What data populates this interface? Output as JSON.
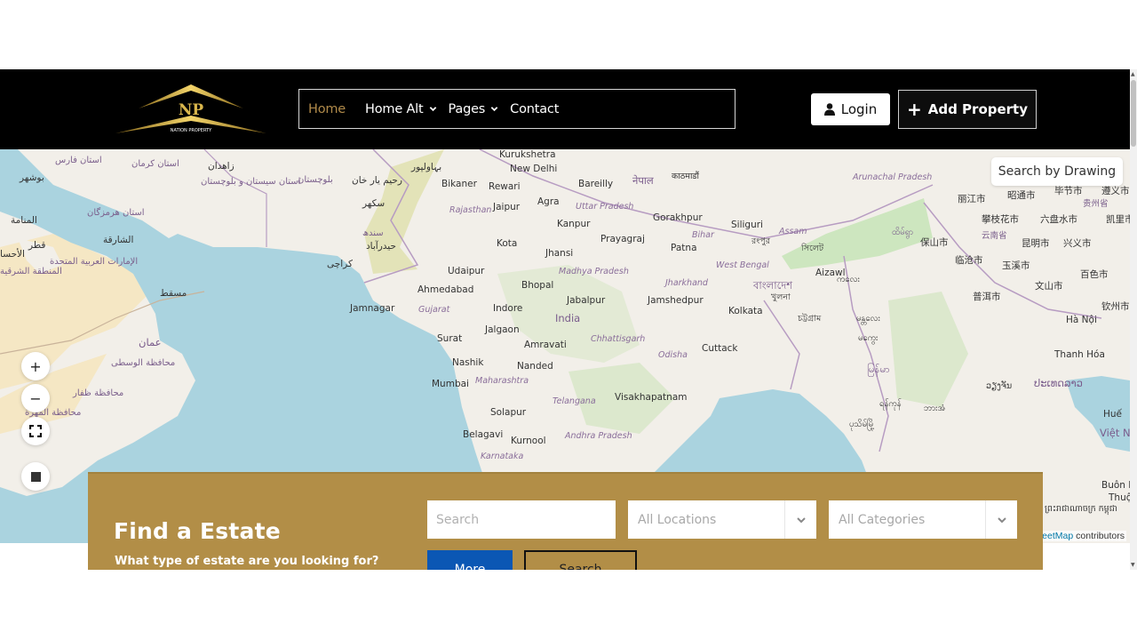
{
  "header": {
    "logo": {
      "initials": "NP",
      "brand": "NATION PROPERTY"
    },
    "nav": [
      {
        "label": "Home",
        "active": true,
        "has_dropdown": false
      },
      {
        "label": "Home Alt",
        "active": false,
        "has_dropdown": true
      },
      {
        "label": "Pages",
        "active": false,
        "has_dropdown": true
      },
      {
        "label": "Contact",
        "active": false,
        "has_dropdown": false
      }
    ],
    "login_label": "Login",
    "add_property_label": "Add Property",
    "icons": {
      "login": "user-icon",
      "add": "plus-icon"
    }
  },
  "map": {
    "search_by_drawing_label": "Search by Drawing",
    "controls": [
      {
        "name": "zoom-in",
        "glyph": "+"
      },
      {
        "name": "zoom-out",
        "glyph": "−"
      },
      {
        "name": "fullscreen",
        "glyph": "fullscreen-icon"
      },
      {
        "name": "draw-stop",
        "glyph": "square-icon"
      }
    ],
    "attribution": {
      "link": "reetMap",
      "text": " contributors"
    },
    "labels": {
      "cities": [
        "Kurukshetra",
        "New Delhi",
        "Bikaner",
        "Rewari",
        "Bareilly",
        "Jaipur",
        "Agra",
        "Gorakhpur",
        "Siliguri",
        "Kanpur",
        "Prayagraj",
        "Kota",
        "Jhansi",
        "Patna",
        "Udaipur",
        "Ahmedabad",
        "Bhopal",
        "Kolkata",
        "Jabalpur",
        "Jamshedpur",
        "Aizawl",
        "Jamnagar",
        "Indore",
        "Jalgaon",
        "Surat",
        "Amravati",
        "Cuttack",
        "Nashik",
        "Nanded",
        "Mumbai",
        "Visakhapatnam",
        "Solapur",
        "Belagavi",
        "Kurnool",
        "Hà Nội",
        "Thanh Hóa",
        "Huế",
        "Buôn M",
        "Thuộ"
      ],
      "states": [
        "Rajasthan",
        "Uttar Pradesh",
        "Bihar",
        "Assam",
        "Arunachal Pradesh",
        "West Bengal",
        "Jharkhand",
        "Madhya Pradesh",
        "Gujarat",
        "Chhattisgarh",
        "Odisha",
        "Maharashtra",
        "Telangana",
        "Andhra Pradesh",
        "Karnataka"
      ],
      "countries": [
        "India",
        "नेपाल",
        "বাংলাদেশ",
        "Việt N"
      ],
      "arabic": [
        "استان فارس",
        "استان کرمان",
        "زاهدان",
        "استان سیستان و بلوچستان",
        "بوشهر",
        "استان هرمزگان",
        "المنامة",
        "قطر",
        "الشارقة",
        "الإمارات العربية المتحدة",
        "الأحسا",
        "المنطقة الشرقية",
        "مسقط",
        "عمان",
        "محافظة الوسطى",
        "محافظة ظفار",
        "محافظة المهرة",
        "بلوچستان",
        "بہاولپور",
        "رحیم یار خان",
        "سکھر",
        "سندھ",
        "حیدرآباد",
        "کراچی"
      ],
      "chinese": [
        "丽江市",
        "昭通市",
        "毕节市",
        "遵义市",
        "贵州省",
        "攀枝花市",
        "六盘水市",
        "凯里市",
        "保山市",
        "云南省",
        "昆明市",
        "兴义市",
        "临沧市",
        "玉溪市",
        "百色市",
        "文山市",
        "普洱市",
        "钦州市"
      ],
      "other": [
        "काठमाडौं",
        "রংপুর",
        "সিলেট",
        "খুলনা",
        "চট্টগ্রাম",
        "ထိမ်ရွာ",
        "ကလေး",
        "မန္တလေး",
        "မကွေး",
        "မြန်မာ",
        "ရန်ကုန်",
        "ပုသိမ်မြို့",
        "ဘားအံ",
        "ວຽງຈັນ",
        "ປະເທດລາວ",
        "ព្រះរាជាណាចក្រ កម្ពុជា"
      ]
    }
  },
  "find_panel": {
    "title": "Find a Estate",
    "subtitle": "What type of estate are you looking for?",
    "search_placeholder": "Search",
    "location_select": "All Locations",
    "category_select": "All Categories",
    "more_label": "More",
    "search_label": "Search"
  },
  "colors": {
    "header_bg": "#000000",
    "brand_gold": "#b08a4a",
    "panel_bg": "#b28e47",
    "more_button": "#0b57b4",
    "water": "#aad3df",
    "land": "#f2efe9"
  }
}
